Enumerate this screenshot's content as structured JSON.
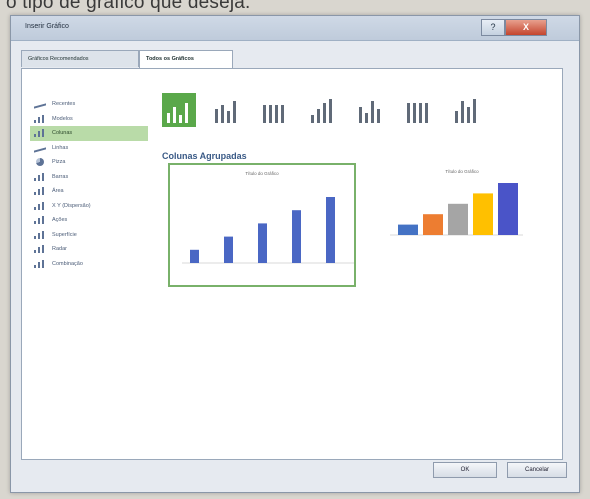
{
  "caption": "o tipo de gráfico que deseja.",
  "window": {
    "title": "Inserir Gráfico",
    "help": "?",
    "close": "X"
  },
  "tabs": [
    {
      "label": "Gráficos Recomendados",
      "active": false
    },
    {
      "label": "Todos os Gráficos",
      "active": true
    }
  ],
  "categories": [
    {
      "label": "Recentes",
      "icon": "recent-icon"
    },
    {
      "label": "Modelos",
      "icon": "folder-icon"
    },
    {
      "label": "Colunas",
      "icon": "column-chart-icon",
      "selected": true
    },
    {
      "label": "Linhas",
      "icon": "line-chart-icon"
    },
    {
      "label": "Pizza",
      "icon": "pie-chart-icon"
    },
    {
      "label": "Barras",
      "icon": "bar-chart-icon"
    },
    {
      "label": "Área",
      "icon": "area-chart-icon"
    },
    {
      "label": "X Y (Dispersão)",
      "icon": "scatter-chart-icon"
    },
    {
      "label": "Ações",
      "icon": "stock-chart-icon"
    },
    {
      "label": "Superfície",
      "icon": "surface-chart-icon"
    },
    {
      "label": "Radar",
      "icon": "radar-chart-icon"
    },
    {
      "label": "Combinação",
      "icon": "combo-chart-icon"
    }
  ],
  "subtype_count": 7,
  "selected_subtype": 0,
  "section_title": "Colunas Agrupadas",
  "preview": {
    "title_left": "Título do Gráfico",
    "title_right": "Título do Gráfico",
    "values": [
      1,
      2,
      3,
      4,
      5
    ],
    "colors": [
      "#4472c4",
      "#ed7d31",
      "#a5a5a5",
      "#ffc000",
      "#4a54c8"
    ],
    "left_bar_color": "#4a67c4"
  },
  "buttons": {
    "ok": "OK",
    "cancel": "Cancelar"
  },
  "colors": {
    "selection": "#b9dba8",
    "selected_subtype": "#5aa84a"
  }
}
